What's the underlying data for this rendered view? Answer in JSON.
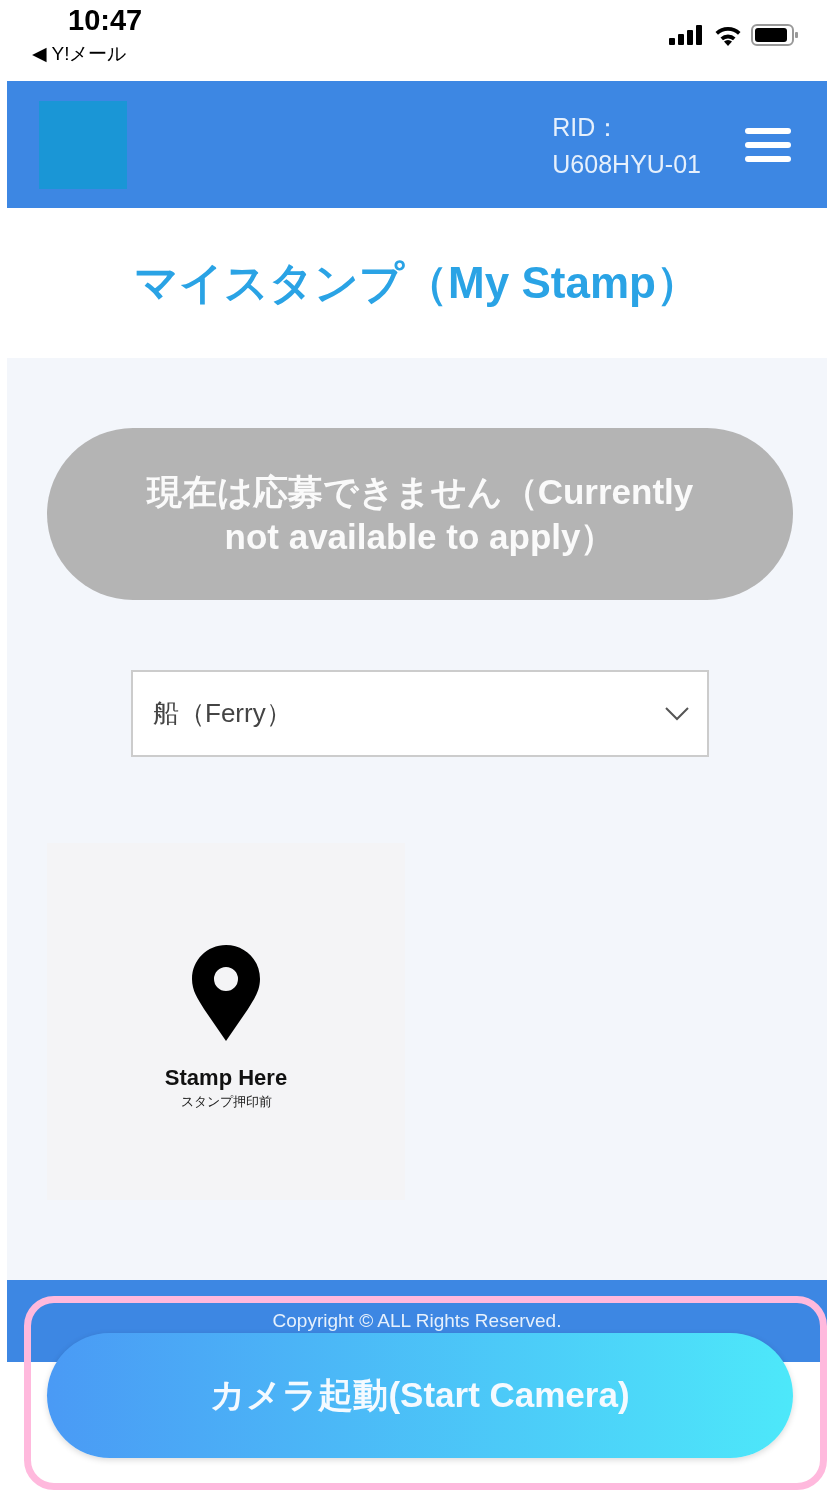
{
  "status_bar": {
    "time": "10:47",
    "back_link": "◀ Y!メール"
  },
  "header": {
    "rid_label": "RID：",
    "rid_value": "U608HYU-01"
  },
  "page_title": "マイスタンプ（My Stamp）",
  "apply_button": {
    "label": "現在は応募できません（Currently not available to apply）",
    "disabled": true
  },
  "category_select": {
    "value": "船（Ferry）"
  },
  "stamps": [
    {
      "title": "Stamp Here",
      "subtitle": "スタンプ押印前",
      "stamped": false
    }
  ],
  "footer": {
    "copyright": "Copyright © ALL Rights Reserved."
  },
  "camera_button": {
    "label": "カメラ起動(Start Camera)"
  }
}
